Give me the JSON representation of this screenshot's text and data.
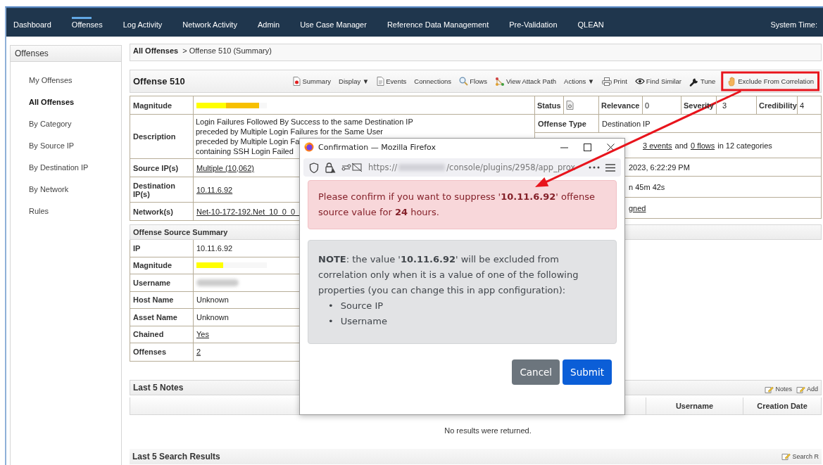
{
  "nav": {
    "tabs": [
      {
        "label": "Dashboard",
        "selected": false
      },
      {
        "label": "Offenses",
        "selected": true
      },
      {
        "label": "Log Activity",
        "selected": false
      },
      {
        "label": "Network Activity",
        "selected": false
      },
      {
        "label": "Admin",
        "selected": false
      },
      {
        "label": "Use Case Manager",
        "selected": false
      },
      {
        "label": "Reference Data Management",
        "selected": false
      },
      {
        "label": "Pre-Validation",
        "selected": false
      },
      {
        "label": "QLEAN",
        "selected": false
      }
    ],
    "system_time": "System Time:"
  },
  "sidebar": {
    "title": "Offenses",
    "items": [
      {
        "label": "My Offenses",
        "selected": false
      },
      {
        "label": "All Offenses",
        "selected": true
      },
      {
        "label": "By Category",
        "selected": false
      },
      {
        "label": "By Source IP",
        "selected": false
      },
      {
        "label": "By Destination IP",
        "selected": false
      },
      {
        "label": "By Network",
        "selected": false
      },
      {
        "label": "Rules",
        "selected": false
      }
    ]
  },
  "breadcrumb": {
    "root": "All Offenses",
    "current": "> Offense 510 (Summary)"
  },
  "offense": {
    "title": "Offense 510",
    "toolbar": [
      {
        "label": "Summary",
        "highlighted": false
      },
      {
        "label": "Display ▼",
        "highlighted": false
      },
      {
        "label": "Events",
        "highlighted": false
      },
      {
        "label": "Connections",
        "highlighted": false
      },
      {
        "label": "Flows",
        "highlighted": false
      },
      {
        "label": "View Attack Path",
        "highlighted": false
      },
      {
        "label": "Actions ▼",
        "highlighted": false
      },
      {
        "label": "Print",
        "highlighted": false
      },
      {
        "label": "Find Similar",
        "highlighted": false
      },
      {
        "label": "Tune",
        "highlighted": false
      },
      {
        "label": "Exclude From Correlation",
        "highlighted": true
      }
    ],
    "details": [
      {
        "label": "Magnitude",
        "kind": "meter",
        "level": 0.89
      },
      {
        "label": "Description",
        "kind": "lines",
        "lines": [
          "Login Failures Followed By Success to the same Destination IP",
          "preceded by Multiple Login Failures for the Same User",
          "preceded by Multiple Login Fa",
          "containing SSH Login Failed"
        ]
      },
      {
        "label": "Source IP(s)",
        "kind": "link",
        "value": "Multiple (10,062)"
      },
      {
        "label": "Destination IP(s)",
        "kind": "link",
        "value": "10.11.6.92"
      },
      {
        "label": "Network(s)",
        "kind": "link",
        "value": "Net-10-172-192.Net_10_0_0_"
      }
    ],
    "status": {
      "label": "Status",
      "relevance_label": "Relevance",
      "relevance": "0",
      "severity_label": "Severity",
      "severity": "3",
      "credibility_label": "Credibility",
      "credibility": "4"
    },
    "offense_type": {
      "label": "Offense Type",
      "value": "Destination IP"
    },
    "right_rows": [
      [
        {
          "text": "3 events",
          "kind": "link"
        },
        {
          "text": "and",
          "kind": "text"
        },
        {
          "text": "0 flows",
          "kind": "link"
        },
        {
          "text": "in 12 categories",
          "kind": "text"
        }
      ],
      [
        {
          "text": "2023, 6:22:29 PM",
          "kind": "text"
        }
      ],
      [
        {
          "text": "n 45m 42s",
          "kind": "text"
        }
      ],
      [
        {
          "text": "gned",
          "kind": "link"
        }
      ]
    ]
  },
  "source_summary": {
    "title": "Offense Source Summary",
    "rows": [
      {
        "label": "IP",
        "kind": "text",
        "value": "10.11.6.92"
      },
      {
        "label": "Magnitude",
        "kind": "meter",
        "level": 0.38
      },
      {
        "label": "Username",
        "kind": "redacted"
      },
      {
        "label": "Host Name",
        "kind": "text",
        "value": "Unknown"
      },
      {
        "label": "Asset Name",
        "kind": "text",
        "value": "Unknown"
      },
      {
        "label": "Chained",
        "kind": "link",
        "value": "Yes"
      },
      {
        "label": "Offenses",
        "kind": "link",
        "value": "2"
      }
    ]
  },
  "notes": {
    "title": "Last 5 Notes",
    "actions": [
      "Notes",
      "Add"
    ],
    "columns": [
      "Username",
      "Creation Date"
    ],
    "empty": "No results were returned."
  },
  "search_results": {
    "title": "Last 5 Search Results",
    "actions": [
      "Search R"
    ]
  },
  "dialog": {
    "title": "Confirmation — Mozilla Firefox",
    "url_scheme": "https://",
    "url_path": "/console/plugins/2958/app_prox",
    "alert": "Please confirm if you want to suppress '**10.11.6.92**' offense source value for **24** hours.",
    "note": "**NOTE**: the value '**10.11.6.92**' will be excluded from correlation only when it is a value of one of the following properties (you can change this in app configuration):",
    "note_items": [
      {
        "marker": "•",
        "text": "Source IP"
      },
      {
        "marker": "•",
        "text": "Username"
      }
    ],
    "buttons": [
      {
        "label": "Cancel",
        "kind": "secondary"
      },
      {
        "label": "Submit",
        "kind": "primary"
      }
    ]
  }
}
